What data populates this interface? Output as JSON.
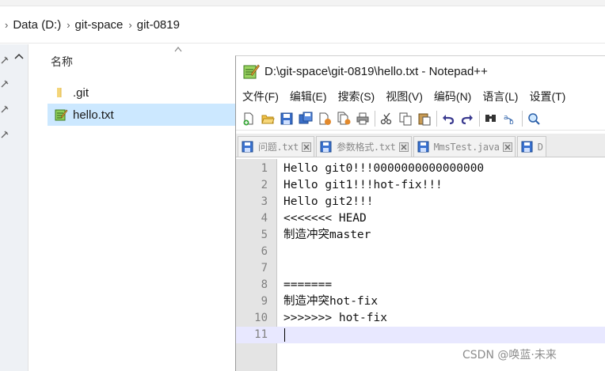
{
  "explorer": {
    "breadcrumb": [
      {
        "label": "Data (D:)"
      },
      {
        "label": "git-space"
      },
      {
        "label": "git-0819"
      }
    ],
    "column_header": "名称",
    "files": [
      {
        "name": ".git",
        "icon": "folder-icon",
        "selected": false
      },
      {
        "name": "hello.txt",
        "icon": "notepadpp-file-icon",
        "selected": true
      }
    ]
  },
  "notepad": {
    "title": "D:\\git-space\\git-0819\\hello.txt - Notepad++",
    "menu": [
      "文件(F)",
      "编辑(E)",
      "搜索(S)",
      "视图(V)",
      "编码(N)",
      "语言(L)",
      "设置(T)"
    ],
    "toolbar_icons": [
      "new-file-icon",
      "open-file-icon",
      "save-icon",
      "save-all-icon",
      "close-icon",
      "close-all-icon",
      "print-icon",
      "cut-icon",
      "copy-icon",
      "paste-icon",
      "undo-icon",
      "redo-icon",
      "find-icon",
      "replace-icon",
      "zoom-icon"
    ],
    "tabs": [
      {
        "label": "问题.txt"
      },
      {
        "label": "参数格式.txt"
      },
      {
        "label": "MmsTest.java"
      },
      {
        "label": "D"
      }
    ],
    "lines": [
      "Hello git0!!!0000000000000000",
      "Hello git1!!!hot-fix!!!",
      "Hello git2!!!",
      "<<<<<<< HEAD",
      "制造冲突master",
      "",
      "",
      "=======",
      "制造冲突hot-fix",
      ">>>>>>> hot-fix",
      ""
    ],
    "current_line": 11
  },
  "watermark": "CSDN @唤蓝·未来"
}
